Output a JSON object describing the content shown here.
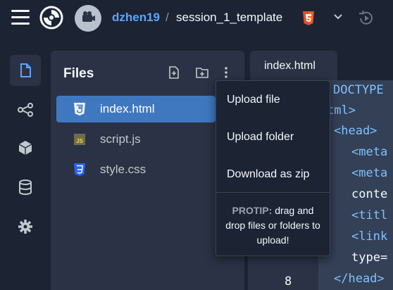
{
  "topbar": {
    "owner": "dzhen19",
    "separator": "/",
    "repl_name": "session_1_template",
    "language_badge": "html5",
    "icons": [
      "menu-icon",
      "replit-logo",
      "avatar",
      "html5-icon",
      "chevron-down-icon",
      "history-icon"
    ]
  },
  "rail": {
    "items": [
      {
        "name": "files-icon",
        "active": true
      },
      {
        "name": "version-control-icon"
      },
      {
        "name": "packages-icon"
      },
      {
        "name": "database-icon"
      },
      {
        "name": "settings-icon"
      }
    ]
  },
  "files": {
    "title": "Files",
    "items": [
      {
        "label": "index.html",
        "icon": "html5-file-icon",
        "selected": true
      },
      {
        "label": "script.js",
        "icon": "js-file-icon"
      },
      {
        "label": "style.css",
        "icon": "css3-file-icon"
      }
    ]
  },
  "editor": {
    "tab_label": "index.html",
    "line_number": "8",
    "lines": [
      "DOCTYPE",
      "tml>",
      "<head>",
      "<meta",
      "<meta",
      "conte",
      "<titl",
      "<link",
      "type=",
      "</head>"
    ]
  },
  "menu": {
    "upload_file": "Upload file",
    "upload_folder": "Upload folder",
    "download_zip": "Download as zip",
    "protip_label": "PROTIP:",
    "protip_text": "drag and drop files or folders to upload!"
  },
  "colors": {
    "background": "#1c2333",
    "panel": "#2b3245",
    "selected": "#4078c0",
    "link": "#5ea3ff",
    "html_orange": "#e44d26",
    "css_blue": "#2965f1",
    "js_yellow": "#f0db4f"
  }
}
